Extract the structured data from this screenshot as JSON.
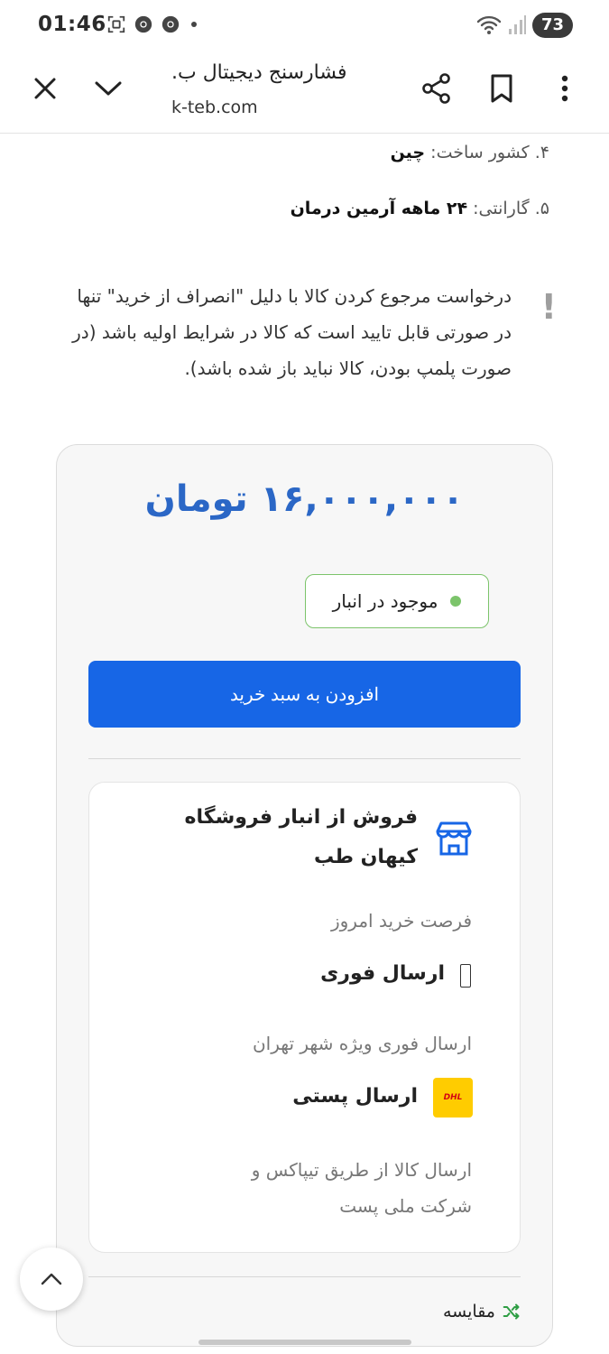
{
  "status_bar": {
    "time": "01:46",
    "battery": "73"
  },
  "browser": {
    "page_title": "فشارسنج دیجیتال ب.",
    "url": "k-teb.com"
  },
  "specs": [
    {
      "label": "۴. کشور ساخت: ",
      "value": "چین"
    },
    {
      "label": "۵. گارانتی: ",
      "value": "۲۴ ماهه آرمین درمان"
    }
  ],
  "notice": {
    "text": "درخواست مرجوع کردن کالا با دلیل \"انصراف از خرید\" تنها در صورتی قابل تایید است که کالا در شرایط اولیه باشد (در صورت پلمپ بودن، کالا نباید باز شده باشد).",
    "icon_glyph": "!"
  },
  "product": {
    "price": "۱۶,۰۰۰,۰۰۰ تومان",
    "stock_status": "موجود در انبار",
    "add_to_cart_label": "افزودن به سبد خرید"
  },
  "seller": {
    "name": "فروش از انبار فروشگاه کیهان طب",
    "opportunity_label": "فرصت خرید امروز",
    "shipping_fast": {
      "title": "ارسال فوری",
      "description": "ارسال فوری ویژه شهر تهران"
    },
    "shipping_post": {
      "title": "ارسال پستی",
      "description": "ارسال کالا از طریق تیپاکس و شرکت ملی پست",
      "logo_text": "DHL"
    }
  },
  "compare": {
    "label": "مقایسه"
  },
  "colors": {
    "price_blue": "#2b67c6",
    "button_blue": "#1766e6",
    "stock_green": "#7cc46b",
    "compare_green": "#2e9e44",
    "dhl_yellow": "#ffcc00"
  }
}
